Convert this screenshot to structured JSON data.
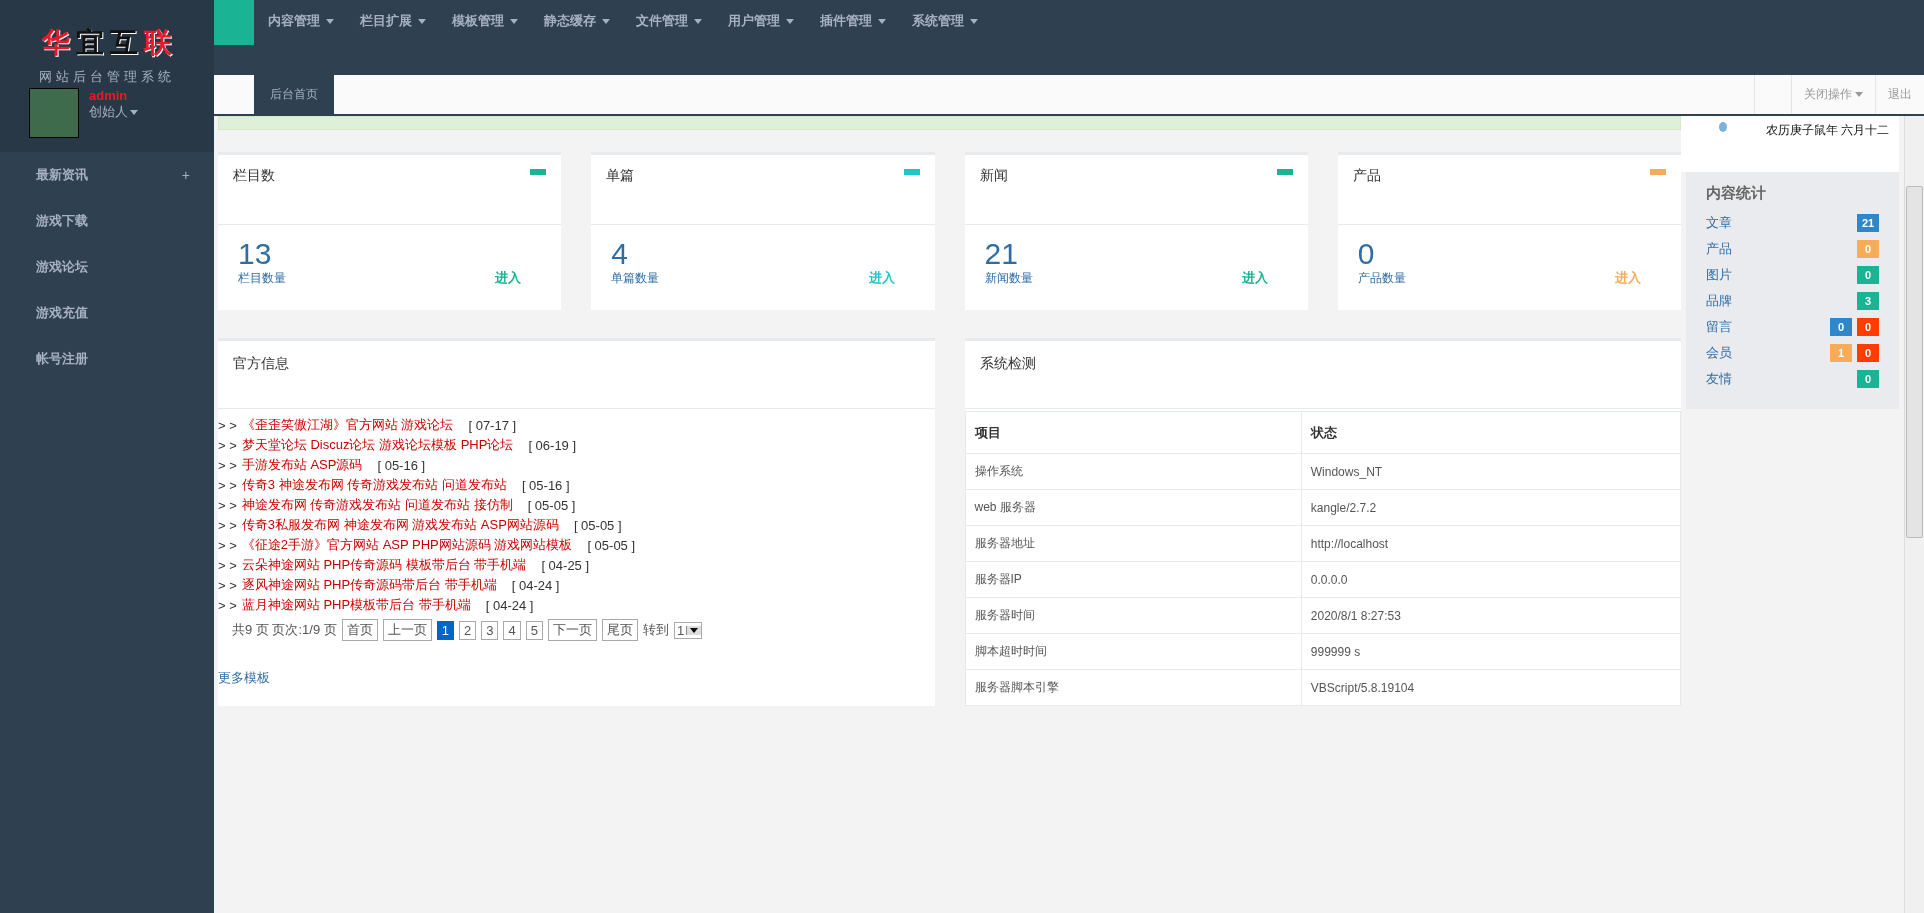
{
  "brand": {
    "title": [
      {
        "text": "华",
        "color": "#e8192c"
      },
      {
        "text": "宜",
        "color": "#111111"
      },
      {
        "text": "互",
        "color": "#111111"
      },
      {
        "text": "联",
        "color": "#e8192c"
      }
    ],
    "subtitle": "网站后台管理系统"
  },
  "user": {
    "name": "admin",
    "role": "创始人"
  },
  "sidebar": {
    "items": [
      {
        "label": "最新资讯",
        "toggle": "+"
      },
      {
        "label": "游戏下载"
      },
      {
        "label": "游戏论坛"
      },
      {
        "label": "游戏充值"
      },
      {
        "label": "帐号注册"
      }
    ]
  },
  "top_nav": [
    "内容管理",
    "栏目扩展",
    "模板管理",
    "静态缓存",
    "文件管理",
    "用户管理",
    "插件管理",
    "系统管理"
  ],
  "tabs": [
    {
      "label": "后台首页",
      "selected": true
    }
  ],
  "tab_actions": [
    {
      "label": "关闭操作",
      "dropdown": true
    },
    {
      "label": "退出",
      "dropdown": false
    }
  ],
  "cards": [
    {
      "title": "栏目数",
      "value": "13",
      "caption": "栏目数量",
      "link": "进入",
      "color": "#1ab394"
    },
    {
      "title": "单篇",
      "value": "4",
      "caption": "单篇数量",
      "link": "进入",
      "color": "#23c6c8"
    },
    {
      "title": "新闻",
      "value": "21",
      "caption": "新闻数量",
      "link": "进入",
      "color": "#1ab394"
    },
    {
      "title": "产品",
      "value": "0",
      "caption": "产品数量",
      "link": "进入",
      "color": "#f8ac59"
    }
  ],
  "news": {
    "title": "官方信息",
    "marker": "> >",
    "items": [
      {
        "title": "《歪歪笑傲江湖》官方网站 游戏论坛",
        "date": "[ 07-17 ]"
      },
      {
        "title": "梦天堂论坛 Discuz论坛 游戏论坛模板 PHP论坛",
        "date": "[ 06-19 ]"
      },
      {
        "title": "手游发布站 ASP源码",
        "date": "[ 05-16 ]"
      },
      {
        "title": "传奇3 神途发布网 传奇游戏发布站 问道发布站",
        "date": "[ 05-16 ]"
      },
      {
        "title": "神途发布网 传奇游戏发布站 问道发布站 接仿制",
        "date": "[ 05-05 ]"
      },
      {
        "title": "传奇3私服发布网 神途发布网 游戏发布站 ASP网站源码",
        "date": "[ 05-05 ]"
      },
      {
        "title": "《征途2手游》官方网站 ASP PHP网站源码 游戏网站模板",
        "date": "[ 05-05 ]"
      },
      {
        "title": "云朵神途网站 PHP传奇源码 模板带后台 带手机端",
        "date": "[ 04-25 ]"
      },
      {
        "title": "逐风神途网站 PHP传奇源码带后台 带手机端",
        "date": "[ 04-24 ]"
      },
      {
        "title": "蓝月神途网站 PHP模板带后台 带手机端",
        "date": "[ 04-24 ]"
      }
    ],
    "pagination": {
      "summary": "共9 页 页次:1/9 页",
      "buttons": [
        {
          "label": "首页",
          "selected": false
        },
        {
          "label": "上一页",
          "selected": false
        },
        {
          "label": "1",
          "selected": true
        },
        {
          "label": "2",
          "selected": false
        },
        {
          "label": "3",
          "selected": false
        },
        {
          "label": "4",
          "selected": false
        },
        {
          "label": "5",
          "selected": false
        },
        {
          "label": "下一页",
          "selected": false
        },
        {
          "label": "尾页",
          "selected": false
        }
      ],
      "goto_label": "转到",
      "goto_value": "1"
    },
    "more": "更多模板"
  },
  "system": {
    "title": "系统检测",
    "columns": [
      "项目",
      "状态"
    ],
    "rows": [
      [
        "操作系统",
        "Windows_NT"
      ],
      [
        "web 服务器",
        "kangle/2.7.2"
      ],
      [
        "服务器地址",
        "http://localhost"
      ],
      [
        "服务器IP",
        "0.0.0.0"
      ],
      [
        "服务器时间",
        "2020/8/1 8:27:53"
      ],
      [
        "脚本超时时间",
        "999999 s"
      ],
      [
        "服务器脚本引擎",
        "VBScript/5.8.19104"
      ]
    ]
  },
  "calendar": {
    "lunar": "农历庚子鼠年  六月十二"
  },
  "stats": {
    "title": "内容统计",
    "rows": [
      {
        "label": "文章",
        "badges": [
          {
            "value": "21",
            "color": "#2f87c8"
          }
        ]
      },
      {
        "label": "产品",
        "badges": [
          {
            "value": "0",
            "color": "#f8ac59"
          }
        ]
      },
      {
        "label": "图片",
        "badges": [
          {
            "value": "0",
            "color": "#1ab394"
          }
        ]
      },
      {
        "label": "品牌",
        "badges": [
          {
            "value": "3",
            "color": "#1ab394"
          }
        ]
      },
      {
        "label": "留言",
        "badges": [
          {
            "value": "0",
            "color": "#2f87c8"
          },
          {
            "value": "0",
            "color": "#ff3d00"
          }
        ]
      },
      {
        "label": "会员",
        "badges": [
          {
            "value": "1",
            "color": "#f8ac59"
          },
          {
            "value": "0",
            "color": "#ff3d00"
          }
        ]
      },
      {
        "label": "友情",
        "badges": [
          {
            "value": "0",
            "color": "#1ab394"
          }
        ]
      }
    ]
  }
}
